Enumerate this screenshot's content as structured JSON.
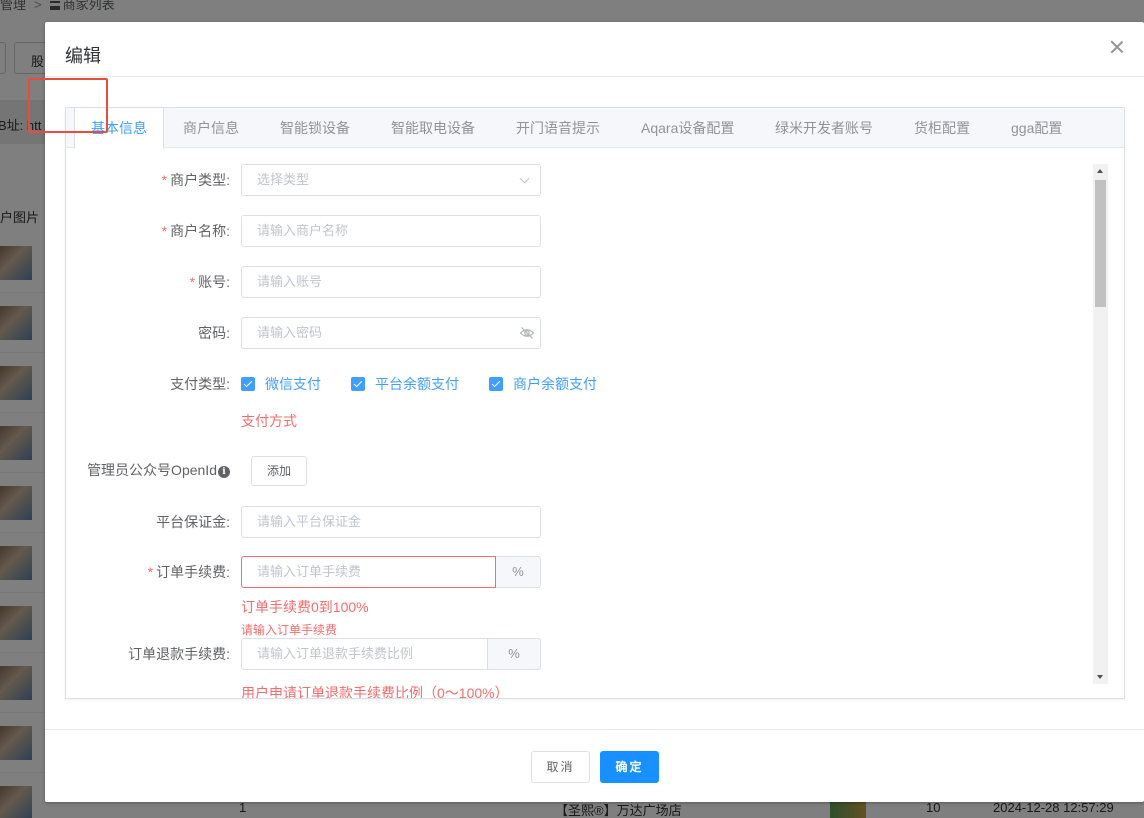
{
  "background": {
    "breadcrumb_part1": "管理",
    "breadcrumb_sep": ">",
    "breadcrumb_part2": "商家列表",
    "button_partial": "股",
    "address_label": "B址:",
    "address_value": "htt",
    "image_header": "户图片",
    "bottom_row": {
      "index": "1",
      "name": "【圣熙®】万达广场店",
      "count": "10",
      "time": "2024-12-28 12:57:29"
    }
  },
  "dialog": {
    "title": "编辑",
    "tabs": [
      {
        "label": "基本信息",
        "active": true
      },
      {
        "label": "商户信息",
        "active": false
      },
      {
        "label": "智能锁设备",
        "active": false
      },
      {
        "label": "智能取电设备",
        "active": false
      },
      {
        "label": "开门语音提示",
        "active": false
      },
      {
        "label": "Aqara设备配置",
        "active": false
      },
      {
        "label": "绿米开发者账号",
        "active": false
      },
      {
        "label": "货柜配置",
        "active": false
      },
      {
        "label": "gga配置",
        "active": false
      }
    ],
    "form": {
      "required_mark": "*",
      "merchant_type": {
        "label": "商户类型:",
        "placeholder": "选择类型"
      },
      "merchant_name": {
        "label": "商户名称:",
        "placeholder": "请输入商户名称"
      },
      "account": {
        "label": "账号:",
        "placeholder": "请输入账号"
      },
      "password": {
        "label": "密码:",
        "placeholder": "请输入密码"
      },
      "payment_type": {
        "label": "支付类型:",
        "options": [
          {
            "label": "微信支付",
            "checked": true
          },
          {
            "label": "平台余额支付",
            "checked": true
          },
          {
            "label": "商户余额支付",
            "checked": true
          }
        ],
        "hint": "支付方式"
      },
      "admin_openid": {
        "label": "管理员公众号OpenId",
        "info_icon": "i",
        "add_button": "添加"
      },
      "platform_deposit": {
        "label": "平台保证金:",
        "placeholder": "请输入平台保证金"
      },
      "order_fee": {
        "label": "订单手续费:",
        "placeholder": "请输入订单手续费",
        "suffix": "%",
        "hint": "订单手续费0到100%",
        "error": "请输入订单手续费"
      },
      "refund_fee": {
        "label": "订单退款手续费:",
        "placeholder": "请输入订单退款手续费比例",
        "suffix": "%",
        "hint": "用户申请订单退款手续费比例（0～100%）"
      }
    },
    "footer": {
      "cancel": "取消",
      "confirm": "确定"
    }
  },
  "colors": {
    "primary": "#409eff",
    "confirm": "#1890ff",
    "error": "#f56c6c",
    "highlight": "#e94b3c"
  }
}
